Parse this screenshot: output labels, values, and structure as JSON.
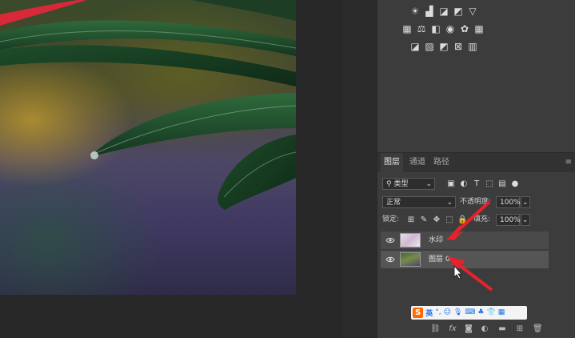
{
  "layers_panel": {
    "tabs": [
      "图层",
      "通道",
      "路径"
    ],
    "filter_kind": "类型",
    "blend_mode": "正常",
    "opacity_label": "不透明度:",
    "opacity_value": "100%",
    "lock_label": "锁定:",
    "fill_label": "填充:",
    "fill_value": "100%",
    "layers": [
      {
        "name": "水印"
      },
      {
        "name": "图层 0"
      }
    ]
  },
  "ime": {
    "logo": "S",
    "mode": "英"
  },
  "colors": {
    "panel_bg": "#3c3c3c",
    "workspace_bg": "#282828",
    "annotation_arrow": "#e8212c",
    "ime_logo": "#ff6a00"
  }
}
